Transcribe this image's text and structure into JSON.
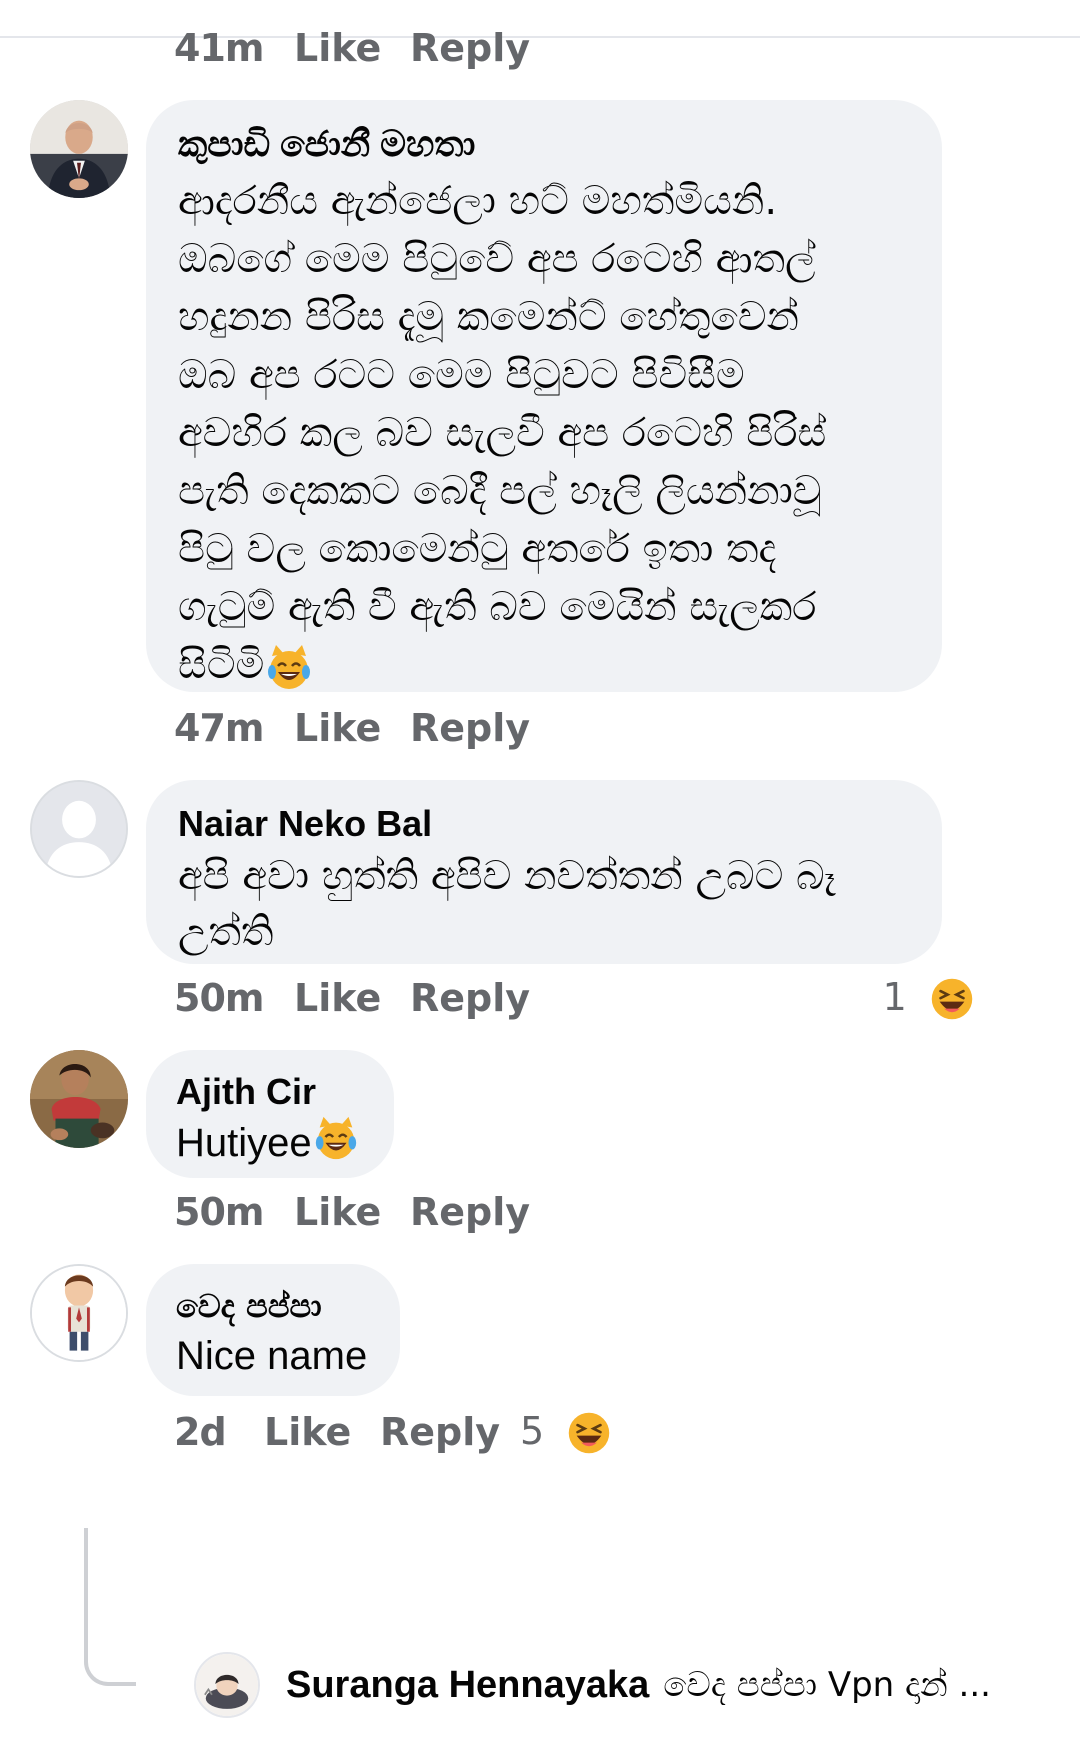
{
  "top_comment_meta": {
    "time": "41m",
    "like": "Like",
    "reply": "Reply"
  },
  "comments": [
    {
      "name": "කුපාඩි ජොනී මහතා",
      "lines": [
        "ආදරනීය ඇන්ජෙලා හට් මහත්මියනි.",
        "ඔබගේ මෙම පිටුවේ අප රටෙහි ආතල්",
        "හදුනන පිරිස දැමූ කමෙන්ට් හේතුවෙන්",
        "ඔබ අප රටට මෙම පිටුවට පිවිසීම",
        "අවහිර කල බව සැලවී අප රටෙහි පිරිස්",
        "පැති දෙකකට බෙදී පල් හෑලි ලියන්නාවූ",
        "පිටු වල කොමෙන්ටු අතරේ ඉතා තද",
        "ගැටුම් ඇති වී ඇති බව මෙයින් සැලකර",
        "සිටිමි"
      ],
      "emoji": "cat-tears-of-joy-icon",
      "time": "47m",
      "like": "Like",
      "reply": "Reply"
    },
    {
      "name": "Naiar Neko Bal",
      "lines": [
        "අපි අවා හුත්ති අපිව නවත්තන් උබට බෑ",
        "උත්ති"
      ],
      "time": "50m",
      "like": "Like",
      "reply": "Reply",
      "reaction_count": "1",
      "reaction_icon": "laughing-face-icon"
    },
    {
      "name": "Ajith Cir",
      "text": "Hutiyee",
      "emoji": "cat-tears-of-joy-icon",
      "time": "50m",
      "like": "Like",
      "reply": "Reply"
    },
    {
      "name": "වෙද පප්පා",
      "text": "Nice name",
      "time": "2d",
      "like": "Like",
      "reply": "Reply",
      "reaction_count": "5",
      "reaction_icon": "laughing-face-icon"
    }
  ],
  "reply_preview": {
    "name": "Suranga Hennayaka",
    "text": "වෙද පප්පා Vpn දාන් ..."
  },
  "colors": {
    "bubble": "#f0f2f5",
    "meta": "#65676b",
    "text": "#050505"
  }
}
